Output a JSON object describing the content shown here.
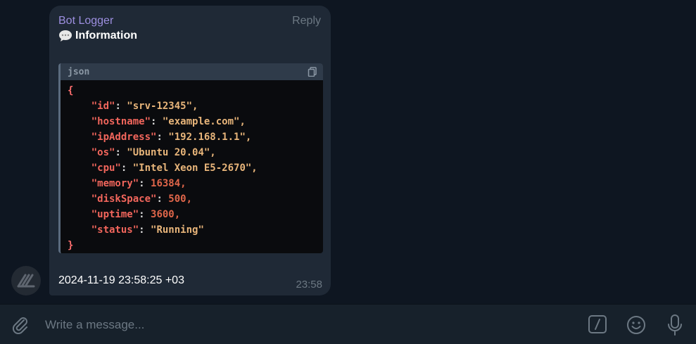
{
  "message": {
    "sender": "Bot Logger",
    "reply_label": "Reply",
    "title": "Information",
    "code_language": "json",
    "code_lines": [
      "{",
      "    \"id\": \"srv-12345\",",
      "    \"hostname\": \"example.com\",",
      "    \"ipAddress\": \"192.168.1.1\",",
      "    \"os\": \"Ubuntu 20.04\",",
      "    \"cpu\": \"Intel Xeon E5-2670\",",
      "    \"memory\": 16384,",
      "    \"diskSpace\": 500,",
      "    \"uptime\": 3600,",
      "    \"status\": \"Running\"",
      "}"
    ],
    "footer_text": "2024-11-19 23:58:25 +03",
    "time": "23:58"
  },
  "composer": {
    "placeholder": "Write a message..."
  },
  "icons": {
    "title": "speech-bubble-icon",
    "copy": "copy-icon",
    "attach": "paperclip-icon",
    "commands": "slash-command-icon",
    "emoji": "smiley-icon",
    "mic": "microphone-icon",
    "avatar": "bot-avatar-icon"
  },
  "colors": {
    "background": "#0e1621",
    "bubble": "#1f2936",
    "sender": "#9d8fe0",
    "muted": "#6c7883",
    "code_bg": "#0a0b0e",
    "code_text": "#f2665c"
  }
}
